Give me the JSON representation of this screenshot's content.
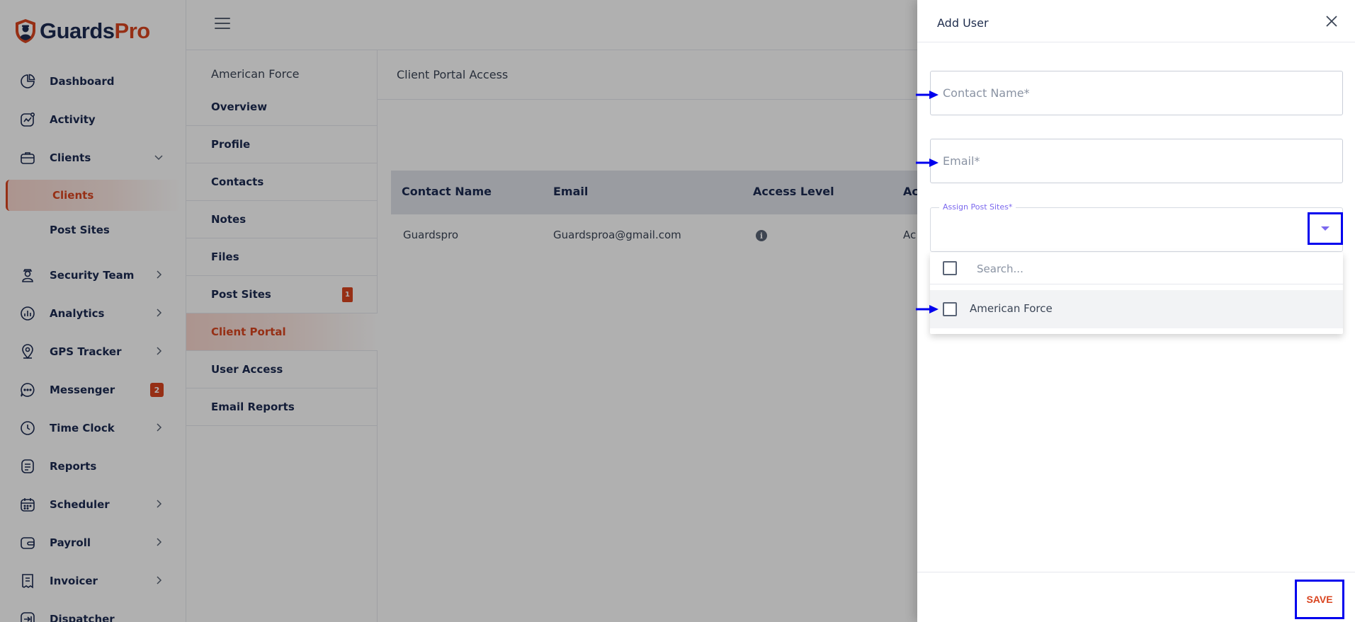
{
  "app": {
    "logo": {
      "part1": "Guards",
      "part2": "Pro"
    },
    "brand_color": "#d9441f",
    "navy_color": "#1c2b52"
  },
  "sidebar": {
    "items": [
      {
        "label": "Dashboard",
        "icon": "pie-chart-icon"
      },
      {
        "label": "Activity",
        "icon": "activity-icon"
      },
      {
        "label": "Clients",
        "icon": "briefcase-icon",
        "expanded": true
      },
      {
        "label": "Security Team",
        "icon": "guard-icon"
      },
      {
        "label": "Analytics",
        "icon": "analytics-icon"
      },
      {
        "label": "GPS Tracker",
        "icon": "location-icon"
      },
      {
        "label": "Messenger",
        "icon": "chat-icon",
        "badge": "2"
      },
      {
        "label": "Time Clock",
        "icon": "clock-icon"
      },
      {
        "label": "Reports",
        "icon": "reports-icon"
      },
      {
        "label": "Scheduler",
        "icon": "calendar-icon"
      },
      {
        "label": "Payroll",
        "icon": "wallet-icon"
      },
      {
        "label": "Invoicer",
        "icon": "invoice-icon"
      },
      {
        "label": "Dispatcher",
        "icon": "dispatch-icon"
      }
    ],
    "sub_items": [
      {
        "label": "Clients",
        "active": true
      },
      {
        "label": "Post Sites"
      }
    ]
  },
  "client_nav": {
    "title": "American Force",
    "items": [
      {
        "label": "Overview"
      },
      {
        "label": "Profile"
      },
      {
        "label": "Contacts"
      },
      {
        "label": "Notes"
      },
      {
        "label": "Files"
      },
      {
        "label": "Post Sites",
        "badge": "1"
      },
      {
        "label": "Client Portal",
        "active": true
      },
      {
        "label": "User Access"
      },
      {
        "label": "Email Reports"
      }
    ]
  },
  "main": {
    "title": "Client Portal Access",
    "table": {
      "headers": [
        "Contact Name",
        "Email",
        "Access Level",
        "Ac"
      ],
      "rows": [
        {
          "name": "Guardspro",
          "email": "Guardsproa@gmail.com",
          "status": "Ac"
        }
      ]
    }
  },
  "drawer": {
    "title": "Add User",
    "contact_name": {
      "placeholder": "Contact Name*",
      "value": ""
    },
    "email": {
      "placeholder": "Email*",
      "value": ""
    },
    "assign_post_sites": {
      "label": "Assign Post Sites*",
      "search_placeholder": "Search...",
      "options": [
        {
          "label": "American Force",
          "checked": false
        }
      ]
    },
    "save_label": "SAVE"
  },
  "annotations": {
    "highlight_color": "#0000ee"
  }
}
